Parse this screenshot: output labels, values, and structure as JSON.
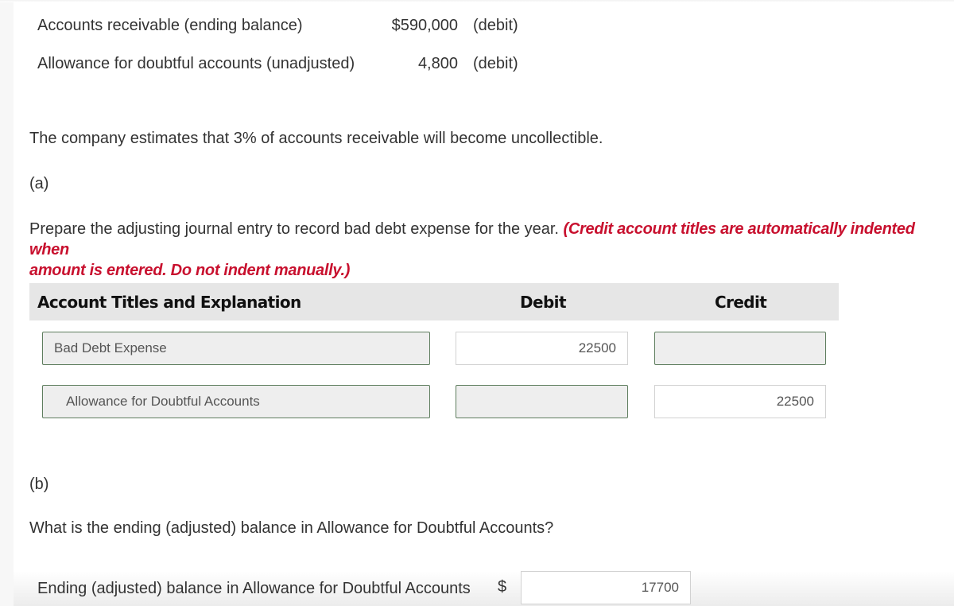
{
  "given": [
    {
      "label": "Accounts receivable (ending balance)",
      "amount": "$590,000",
      "side": "(debit)"
    },
    {
      "label": "Allowance for doubtful accounts (unadjusted)",
      "amount": "4,800",
      "side": "(debit)"
    }
  ],
  "estimate_text": "The company estimates that 3% of accounts receivable will become uncollectible.",
  "part_a": {
    "label": "(a)",
    "instruction": "Prepare the adjusting journal entry to record bad debt expense for the year.",
    "note_line1": "(Credit account titles are automatically indented when",
    "note_line2": "amount is entered. Do not indent manually.)",
    "table": {
      "headers": {
        "account": "Account Titles and Explanation",
        "debit": "Debit",
        "credit": "Credit"
      },
      "rows": [
        {
          "account": "Bad Debt Expense",
          "debit": "22500",
          "credit": ""
        },
        {
          "account": "Allowance for Doubtful Accounts",
          "debit": "",
          "credit": "22500"
        }
      ]
    }
  },
  "part_b": {
    "label": "(b)",
    "question": "What is the ending (adjusted) balance in Allowance for Doubtful Accounts?",
    "answer_label": "Ending (adjusted) balance in Allowance for Doubtful Accounts",
    "currency": "$",
    "answer_value": "17700"
  },
  "colors": {
    "note_red": "#c8102e",
    "empty_field_border": "#5e7d5e",
    "header_bg": "#e6e6e6"
  }
}
